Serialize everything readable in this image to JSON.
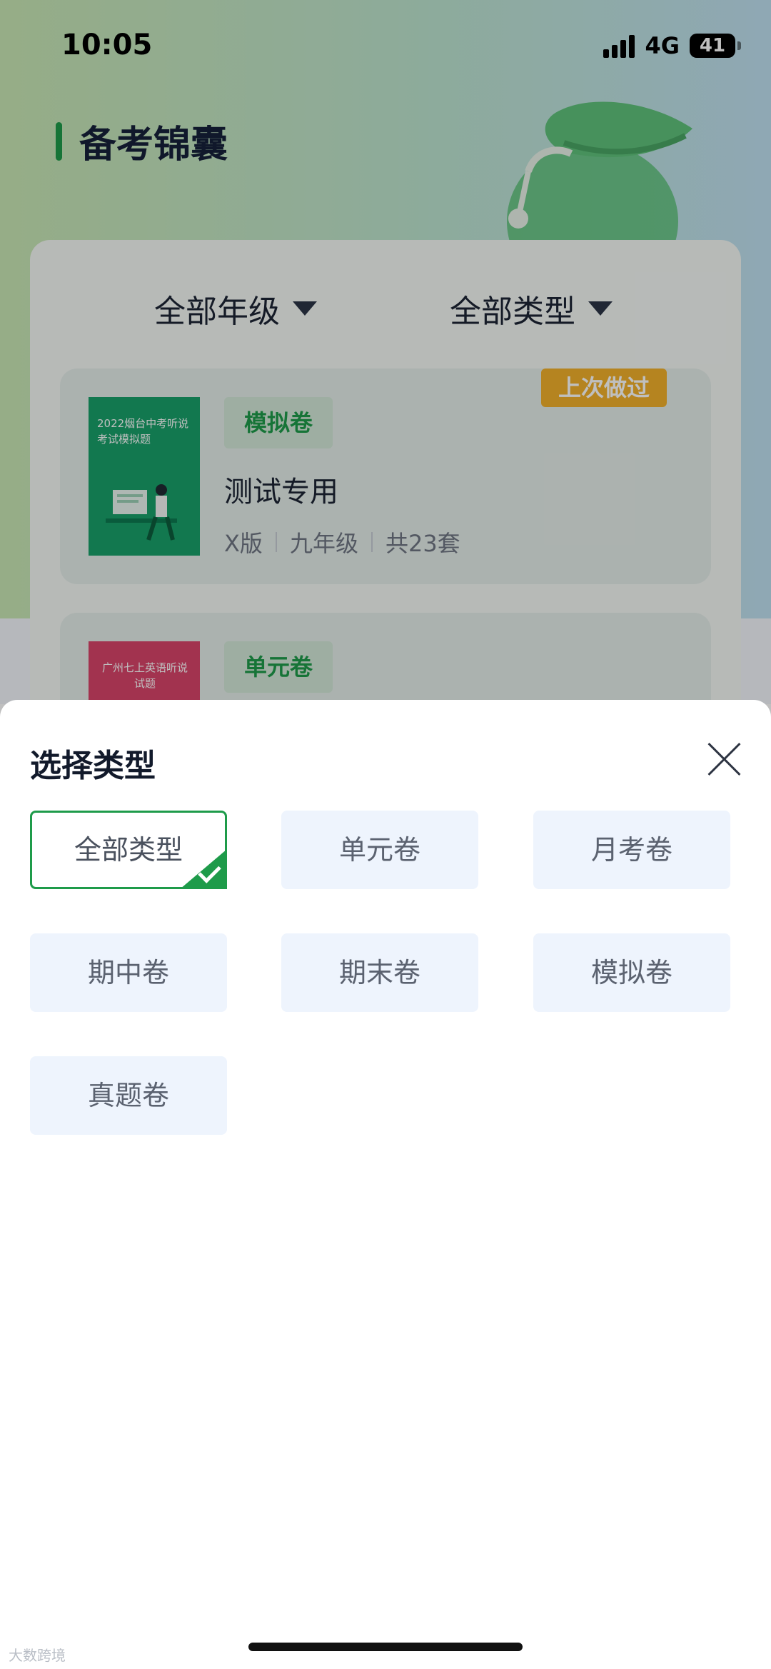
{
  "status_bar": {
    "time": "10:05",
    "network": "4G",
    "battery": "41"
  },
  "header": {
    "title": "备考锦囊"
  },
  "filters": {
    "grade_label": "全部年级",
    "type_label": "全部类型"
  },
  "books": [
    {
      "cover_text": "2022烟台中考听说考试模拟题",
      "tag": "模拟卷",
      "name": "测试专用",
      "meta": [
        "X版",
        "九年级",
        "共23套"
      ],
      "badge": "上次做过",
      "cover_color": "#18a06a"
    },
    {
      "cover_text": "广州七上英语听说试题",
      "tag": "单元卷",
      "cover_color": "#d8446a"
    }
  ],
  "sheet": {
    "title": "选择类型",
    "options": [
      "全部类型",
      "单元卷",
      "月考卷",
      "期中卷",
      "期末卷",
      "模拟卷",
      "真题卷"
    ],
    "selected": "全部类型"
  },
  "watermark": "大数跨境",
  "colors": {
    "accent": "#1e9b4a",
    "badge": "#f2b12b",
    "option_bg": "#eef4fd"
  }
}
